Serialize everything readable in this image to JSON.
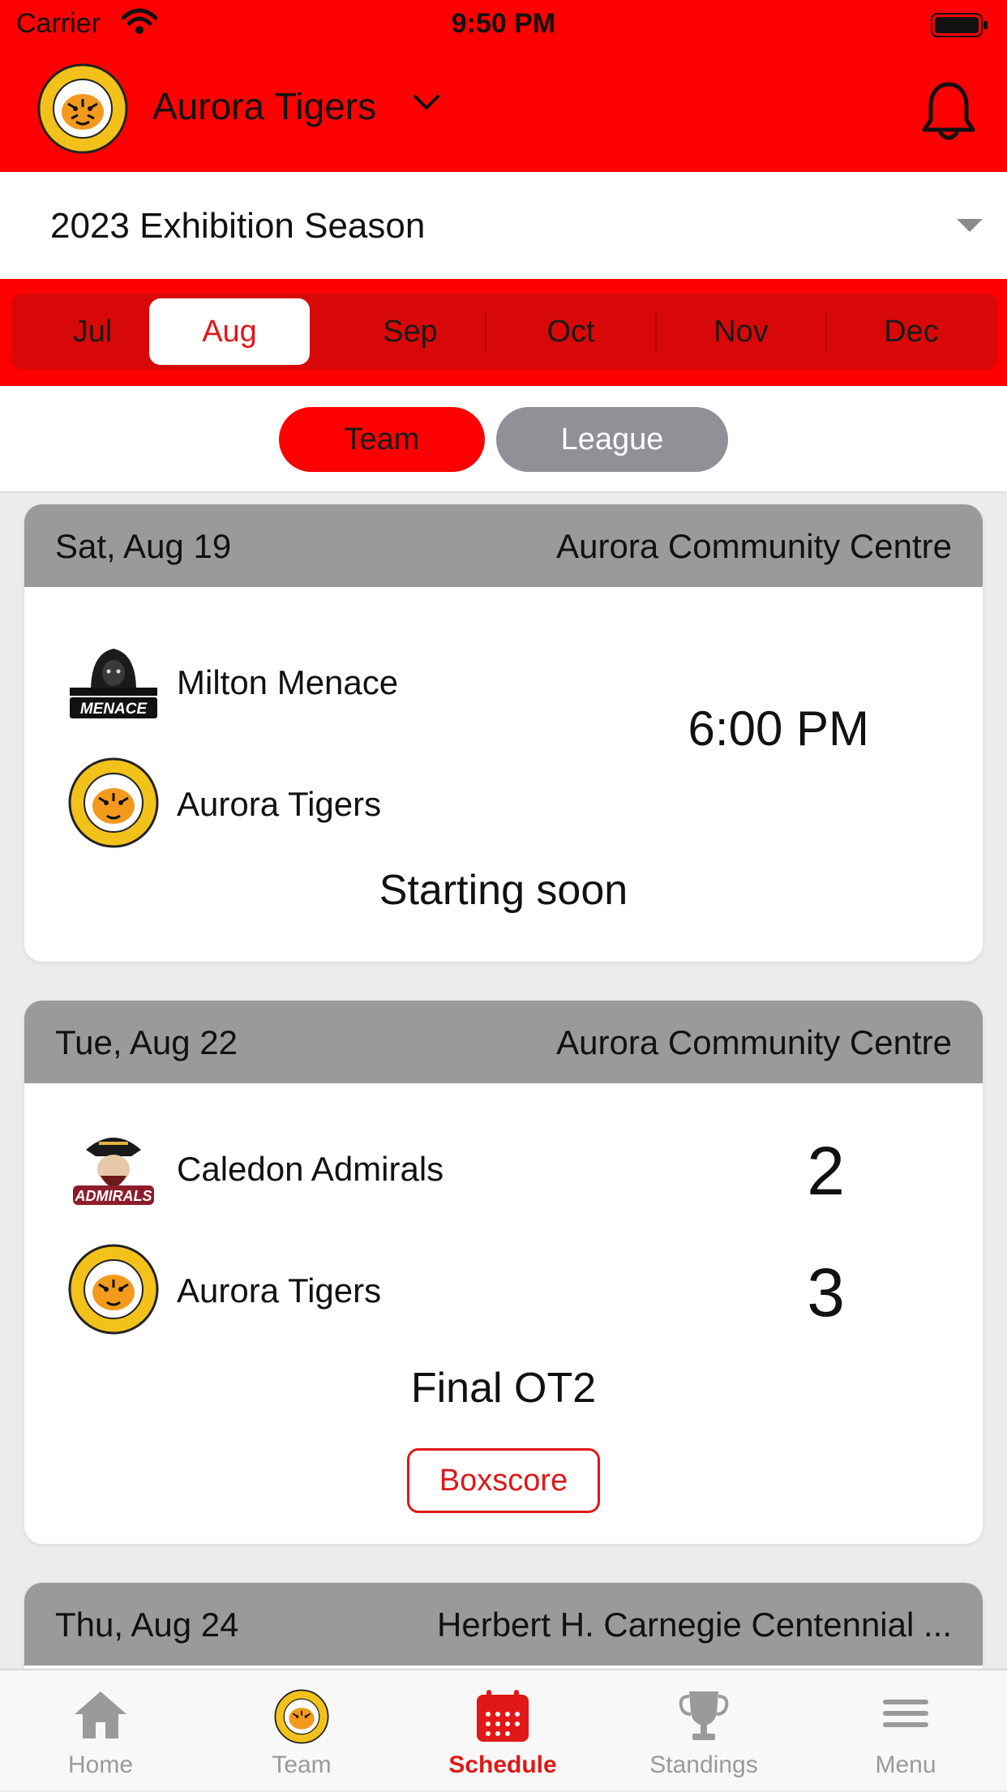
{
  "status_bar": {
    "carrier": "Carrier",
    "time": "9:50 PM"
  },
  "header": {
    "team_name": "Aurora Tigers"
  },
  "season": {
    "label": "2023 Exhibition Season"
  },
  "months": {
    "items": [
      "Jul",
      "Aug",
      "Sep",
      "Oct",
      "Nov",
      "Dec"
    ],
    "selected": "Aug"
  },
  "scope_toggle": {
    "team": "Team",
    "league": "League",
    "selected": "Team"
  },
  "games": [
    {
      "date": "Sat, Aug 19",
      "venue": "Aurora Community Centre",
      "away_team": "Milton Menace",
      "home_team": "Aurora Tigers",
      "time": "6:00 PM",
      "status": "Starting soon"
    },
    {
      "date": "Tue, Aug 22",
      "venue": "Aurora Community Centre",
      "away_team": "Caledon Admirals",
      "home_team": "Aurora Tigers",
      "away_score": "2",
      "home_score": "3",
      "status": "Final OT2",
      "boxscore_label": "Boxscore"
    },
    {
      "date": "Thu, Aug 24",
      "venue": "Herbert H. Carnegie Centennial ..."
    }
  ],
  "tab_bar": {
    "items": [
      {
        "label": "Home",
        "icon": "home-icon"
      },
      {
        "label": "Team",
        "icon": "team-logo-icon"
      },
      {
        "label": "Schedule",
        "icon": "calendar-icon"
      },
      {
        "label": "Standings",
        "icon": "trophy-icon"
      },
      {
        "label": "Menu",
        "icon": "hamburger-menu-icon"
      }
    ],
    "selected": "Schedule"
  },
  "colors": {
    "brand_red": "#fe0000",
    "accent_red": "#e01818",
    "card_header_gray": "#9a9a9a",
    "league_pill_gray": "#8f9196"
  }
}
